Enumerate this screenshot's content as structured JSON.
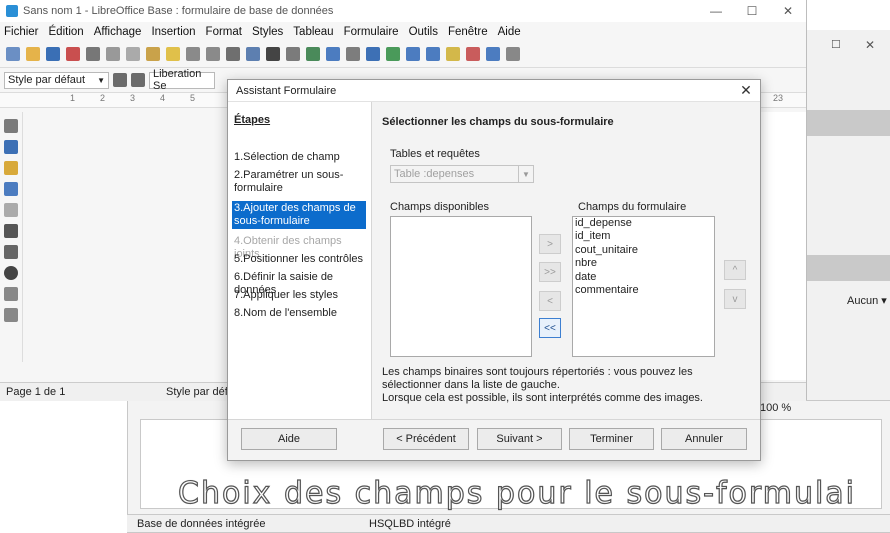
{
  "window": {
    "title": "Sans nom 1 - LibreOffice Base : formulaire de base de données",
    "controls": [
      "—",
      "☐",
      "✕"
    ]
  },
  "menu": [
    "Fichier",
    "Édition",
    "Affichage",
    "Insertion",
    "Format",
    "Styles",
    "Tableau",
    "Formulaire",
    "Outils",
    "Fenêtre",
    "Aide"
  ],
  "format_bar": {
    "para_style": "Style par défaut",
    "font_name": "Liberation Se"
  },
  "ruler": {
    "marks": [
      "1",
      "2",
      "3",
      "4",
      "5"
    ],
    "right_mark": "23"
  },
  "status": {
    "page": "Page 1 de 1",
    "style": "Style par déf",
    "zoom": "100 %"
  },
  "bg_right": {
    "dropdown": "Aucun ▾"
  },
  "dialog": {
    "title": "Assistant Formulaire",
    "close": "✕",
    "steps_header": "Étapes",
    "steps": [
      "1.Sélection de champ",
      "2.Paramétrer un sous-formulaire",
      "3.Ajouter des champs de sous-formulaire",
      "4.Obtenir des champs joints",
      "5.Positionner les contrôles",
      "6.Définir la saisie de données",
      "7.Appliquer les styles",
      "8.Nom de l'ensemble"
    ],
    "active_step": 2,
    "disabled_step": 3,
    "heading": "Sélectionner les champs du sous-formulaire",
    "tables_label": "Tables et requêtes",
    "tables_value": "Table :depenses",
    "available_label": "Champs disponibles",
    "available_fields": [],
    "form_fields_label": "Champs du formulaire",
    "form_fields": [
      "id_depense",
      "id_item",
      "cout_unitaire",
      "nbre",
      "date",
      "commentaire"
    ],
    "move_buttons": [
      ">",
      ">>",
      "<",
      "<<"
    ],
    "order_buttons": [
      "^",
      "v"
    ],
    "info": "Les champs binaires sont toujours répertoriés : vous pouvez les sélectionner dans la liste de gauche.\nLorsque cela est possible, ils sont interprétés comme des images.",
    "buttons": {
      "help": "Aide",
      "prev": "< Précédent",
      "next": "Suivant >",
      "finish": "Terminer",
      "cancel": "Annuler"
    }
  },
  "caption": "Choix des champs pour le sous-formulai",
  "bottom_status": {
    "left": "Base de données intégrée",
    "right": "HSQLBD intégré"
  }
}
